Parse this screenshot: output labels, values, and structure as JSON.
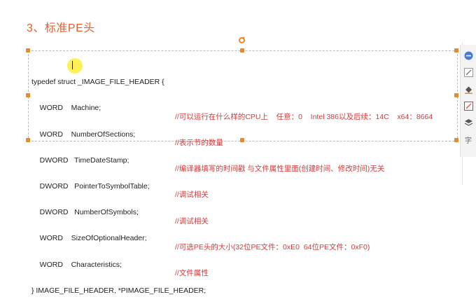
{
  "heading": "3、标准PE头",
  "code": {
    "open_line": "typedef struct _IMAGE_FILE_HEADER {",
    "fields": [
      {
        "decl": "    WORD    Machine;",
        "comment": "//可以运行在什么样的CPU上    任意：0    Intel 386以及后续：14C    x64：8664"
      },
      {
        "decl": "    WORD    NumberOfSections;",
        "comment": "//表示节的数量"
      },
      {
        "decl": "    DWORD   TimeDateStamp;",
        "comment": "//编译器填写的时间戳 与文件属性里面(创建时间、修改时间)无关"
      },
      {
        "decl": "    DWORD   PointerToSymbolTable;",
        "comment": "//调试相关"
      },
      {
        "decl": "    DWORD   NumberOfSymbols;",
        "comment": "//调试相关"
      },
      {
        "decl": "    WORD    SizeOfOptionalHeader;",
        "comment": "//可选PE头的大小(32位PE文件：0xE0  64位PE文件：0xF0)"
      },
      {
        "decl": "    WORD    Characteristics;",
        "comment": "//文件属性"
      }
    ],
    "close_line": "} IMAGE_FILE_HEADER, *PIMAGE_FILE_HEADER;"
  },
  "toolbar": {
    "tools": [
      "minus-circle-icon",
      "edit-icon",
      "fill-icon",
      "crop-icon",
      "layers-icon",
      "text-icon"
    ],
    "text_tool_label": "字"
  },
  "colors": {
    "heading": "#e8602c",
    "comment": "#d43a3a",
    "handle": "#e8892a",
    "highlight": "#ffec28"
  }
}
